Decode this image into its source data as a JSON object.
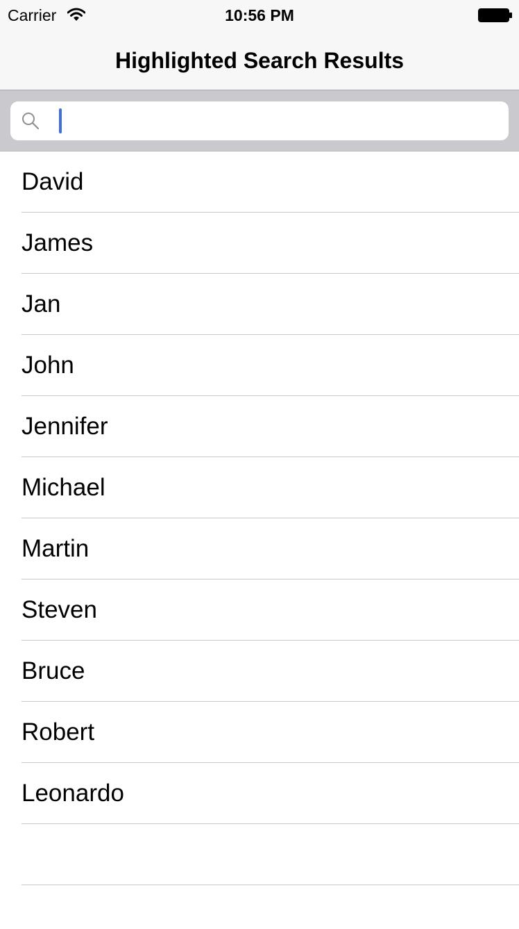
{
  "status_bar": {
    "carrier": "Carrier",
    "time": "10:56 PM",
    "icons": [
      "wifi-icon",
      "battery-icon"
    ]
  },
  "nav": {
    "title": "Highlighted Search Results"
  },
  "search": {
    "value": "",
    "placeholder": "",
    "icon": "search-icon",
    "cursor_color": "#3f6fdc"
  },
  "table": {
    "items": [
      {
        "label": "David"
      },
      {
        "label": "James"
      },
      {
        "label": "Jan"
      },
      {
        "label": "John"
      },
      {
        "label": "Jennifer"
      },
      {
        "label": "Michael"
      },
      {
        "label": "Martin"
      },
      {
        "label": "Steven"
      },
      {
        "label": "Bruce"
      },
      {
        "label": "Robert"
      },
      {
        "label": "Leonardo"
      },
      {
        "label": ""
      }
    ]
  },
  "colors": {
    "nav_background": "#f7f7f7",
    "search_bar_background": "#c9c9ce",
    "separator": "#c8c7cc"
  }
}
